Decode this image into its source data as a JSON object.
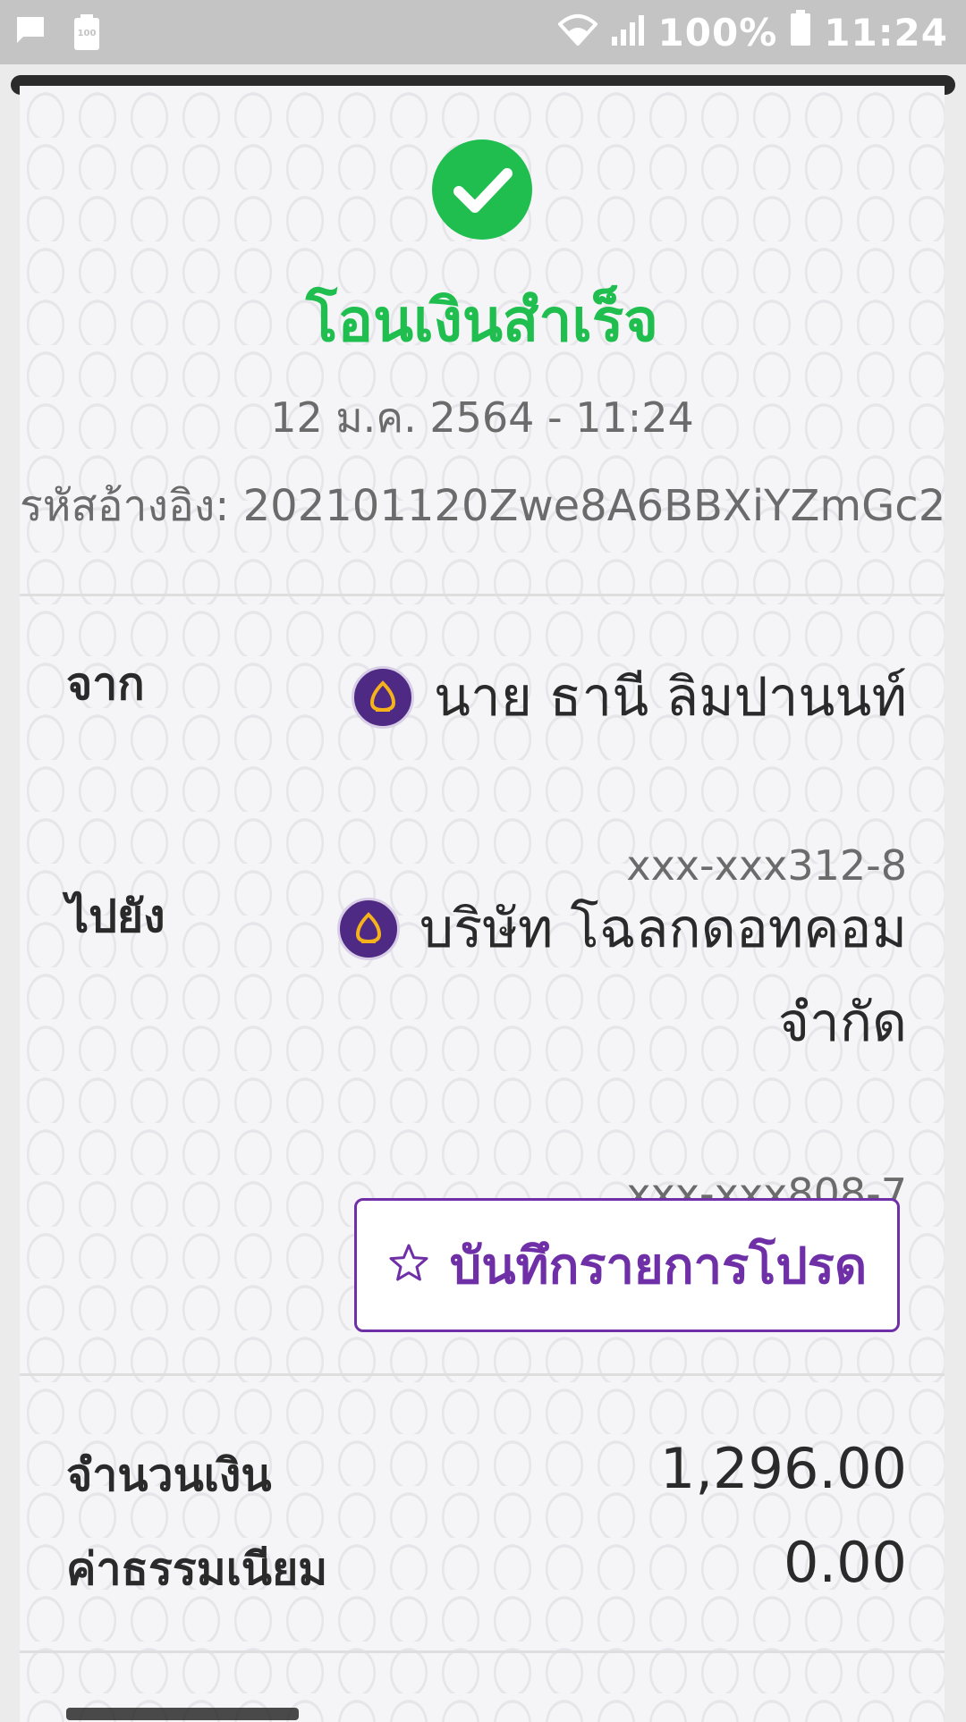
{
  "status_bar": {
    "battery_percent": "100%",
    "time": "11:24",
    "battery_icon_label": "100",
    "icons": [
      "message-icon",
      "battery-saver-icon",
      "wifi-icon",
      "signal-icon",
      "battery-icon"
    ]
  },
  "receipt": {
    "title": "โอนเงินสำเร็จ",
    "date": "12 ม.ค. 2564 - 11:24",
    "reference": "รหัสอ้างอิง: 202101120Zwe8A6BBXiYZmGc2",
    "from": {
      "label": "จาก",
      "name": "นาย ธานี ลิมปานนท์",
      "account": "xxx-xxx312-8"
    },
    "to": {
      "label": "ไปยัง",
      "name_line1": "บริษัท โฉลกดอทคอม",
      "name_line2": "จำกัด",
      "account": "xxx-xxx808-7"
    },
    "favorite_button": "บันทึกรายการโปรด",
    "amount": {
      "label": "จำนวนเงิน",
      "value": "1,296.00"
    },
    "fee": {
      "label": "ค่าธรรมเนียม",
      "value": "0.00"
    }
  },
  "colors": {
    "success_green": "#1fbe4f",
    "brand_purple": "#6f2fa6",
    "bank_logo": "#4e2a84",
    "bank_logo_accent": "#f5b21b"
  }
}
